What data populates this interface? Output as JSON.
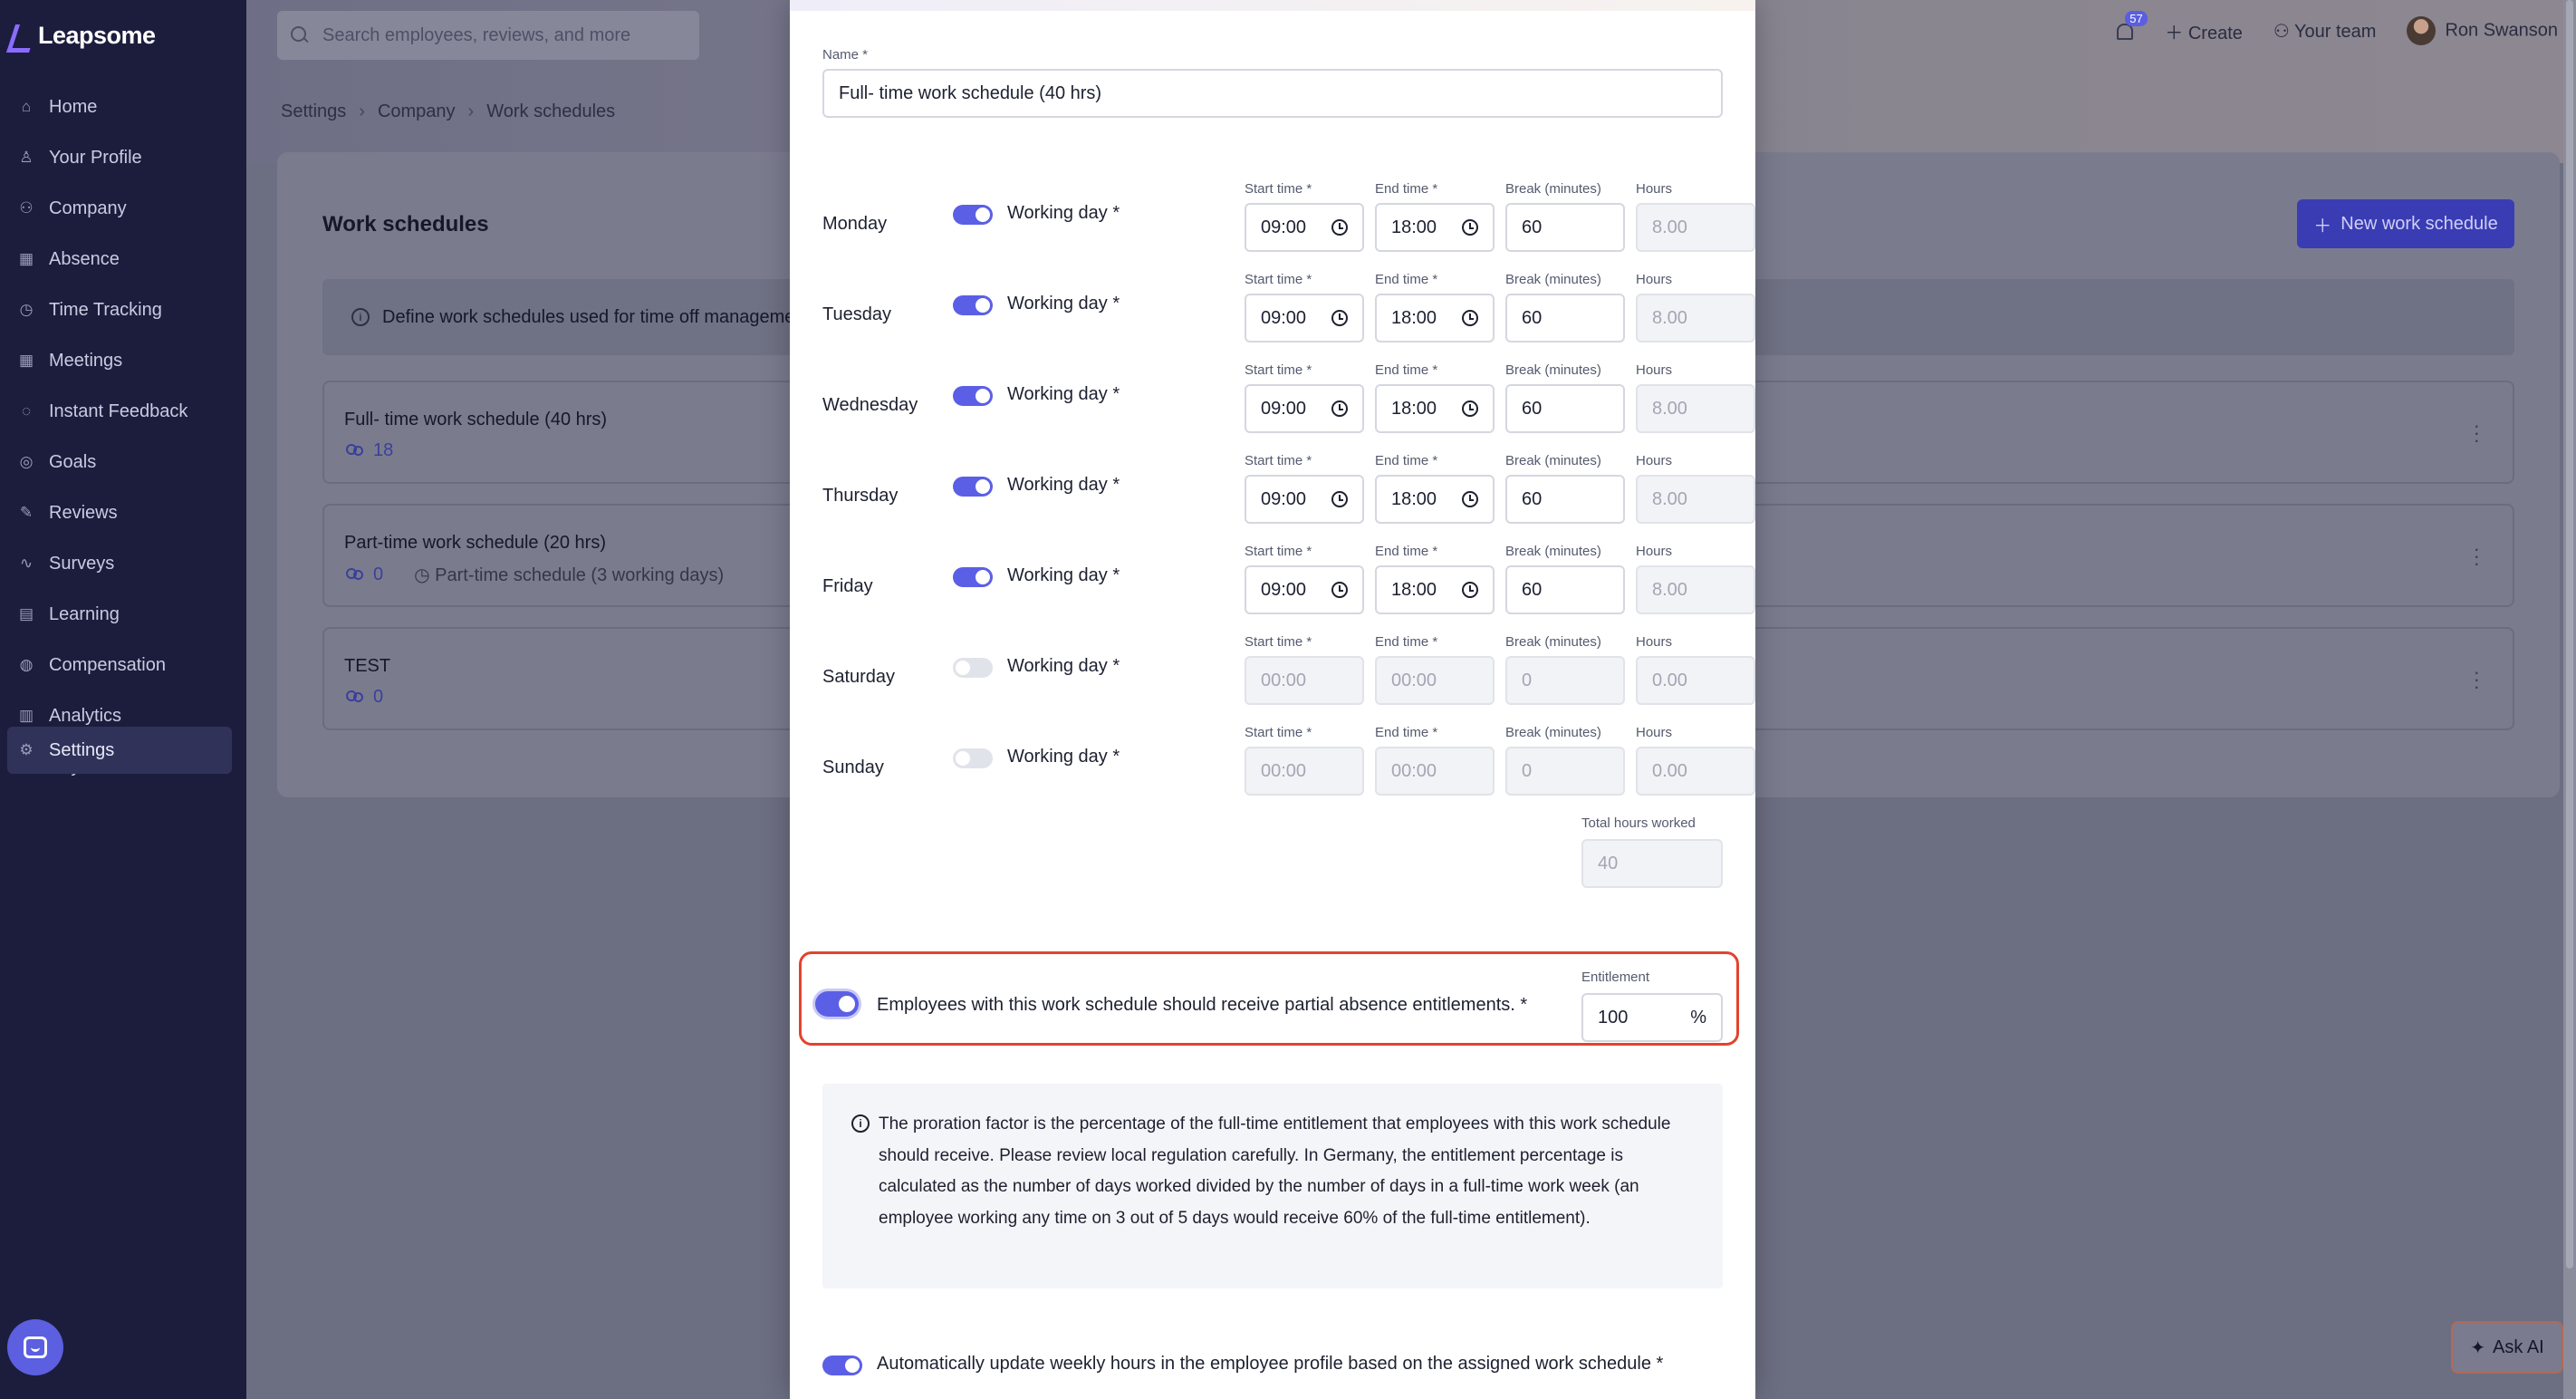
{
  "app": {
    "brand": "Leapsome"
  },
  "sidebar": {
    "items": [
      {
        "label": "Home",
        "icon": "home-icon"
      },
      {
        "label": "Your Profile",
        "icon": "user-icon"
      },
      {
        "label": "Company",
        "icon": "people-icon"
      },
      {
        "label": "Absence",
        "icon": "calendar-icon"
      },
      {
        "label": "Time Tracking",
        "icon": "clock-icon"
      },
      {
        "label": "Meetings",
        "icon": "calendar-icon"
      },
      {
        "label": "Instant Feedback",
        "icon": "chat-icon"
      },
      {
        "label": "Goals",
        "icon": "target-icon"
      },
      {
        "label": "Reviews",
        "icon": "pencil-icon"
      },
      {
        "label": "Surveys",
        "icon": "pulse-icon"
      },
      {
        "label": "Learning",
        "icon": "book-icon"
      },
      {
        "label": "Compensation",
        "icon": "coins-icon"
      },
      {
        "label": "Analytics",
        "icon": "chart-icon"
      },
      {
        "label": "Payroll",
        "icon": "wallet-icon"
      }
    ],
    "settings": "Settings"
  },
  "header": {
    "search_placeholder": "Search employees, reviews, and more",
    "notifications_count": "57",
    "create": "Create",
    "your_team": "Your team",
    "user": "Ron Swanson"
  },
  "breadcrumb": [
    "Settings",
    "Company",
    "Work schedules"
  ],
  "background": {
    "title": "Work schedules",
    "info": "Define work schedules used for time off manageme",
    "new_button": "New work schedule",
    "schedules": [
      {
        "name": "Full- time work schedule (40 hrs)",
        "count": "18",
        "sub": ""
      },
      {
        "name": "Part-time work schedule (20 hrs)",
        "count": "0",
        "sub": "Part-time schedule (3 working days)"
      },
      {
        "name": "TEST",
        "count": "0",
        "sub": ""
      }
    ]
  },
  "modal": {
    "name_label": "Name *",
    "name_value": "Full- time work schedule (40 hrs)",
    "labels": {
      "working_day": "Working day *",
      "start": "Start time *",
      "end": "End time *",
      "break": "Break (minutes)",
      "hours": "Hours"
    },
    "days": [
      {
        "day": "Monday",
        "on": true,
        "start": "09:00",
        "end": "18:00",
        "break": "60",
        "hours": "8.00"
      },
      {
        "day": "Tuesday",
        "on": true,
        "start": "09:00",
        "end": "18:00",
        "break": "60",
        "hours": "8.00"
      },
      {
        "day": "Wednesday",
        "on": true,
        "start": "09:00",
        "end": "18:00",
        "break": "60",
        "hours": "8.00"
      },
      {
        "day": "Thursday",
        "on": true,
        "start": "09:00",
        "end": "18:00",
        "break": "60",
        "hours": "8.00"
      },
      {
        "day": "Friday",
        "on": true,
        "start": "09:00",
        "end": "18:00",
        "break": "60",
        "hours": "8.00"
      },
      {
        "day": "Saturday",
        "on": false,
        "start": "00:00",
        "end": "00:00",
        "break": "0",
        "hours": "0.00"
      },
      {
        "day": "Sunday",
        "on": false,
        "start": "00:00",
        "end": "00:00",
        "break": "0",
        "hours": "0.00"
      }
    ],
    "total_label": "Total hours worked",
    "total_value": "40",
    "partial_label": "Employees with this work schedule should receive partial absence entitlements. *",
    "entitlement_label": "Entitlement",
    "entitlement_value": "100",
    "entitlement_unit": "%",
    "proration_info": "The proration factor is the percentage of the full-time entitlement that employees with this work schedule should receive. Please review local regulation carefully. In Germany, the entitlement percentage is calculated as the number of days worked divided by the number of days in a full-time work week (an employee working any time on 3 out of 5 days would receive 60% of the full-time entitlement).",
    "auto_update_label": "Automatically update weekly hours in the employee profile based on the assigned work schedule *"
  },
  "ask_ai": "Ask AI"
}
